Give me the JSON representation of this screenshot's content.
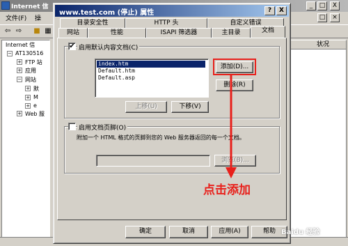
{
  "background_window": {
    "title": "Internet 信",
    "title_buttons": [
      "_",
      "□",
      "X"
    ],
    "menu": [
      "文件(F)",
      "操"
    ],
    "tree": [
      {
        "label": "Internet 信",
        "expander": ""
      },
      {
        "label": "AT130516",
        "expander": "−"
      },
      {
        "label": "FTP 站",
        "expander": "+"
      },
      {
        "label": "应用",
        "expander": "+"
      },
      {
        "label": "网站",
        "expander": "−"
      },
      {
        "label": "默",
        "expander": "+"
      },
      {
        "label": "M",
        "expander": "+"
      },
      {
        "label": "e",
        "expander": "+"
      },
      {
        "label": "Web 服",
        "expander": "+"
      }
    ],
    "list_header": "状况"
  },
  "dialog": {
    "title": "www.test.com (停止) 属性",
    "help_button": "?",
    "close_button": "X",
    "tabs_back": [
      "目录安全性",
      "HTTP 头",
      "自定义错误"
    ],
    "tabs_front": [
      "网站",
      "性能",
      "ISAPI 筛选器",
      "主目录",
      "文档"
    ],
    "active_tab": "文档",
    "default_doc": {
      "checkbox_label": "启用默认内容文档(C)",
      "checked": true,
      "documents": [
        "index.htm",
        "Default.htm",
        "Default.asp"
      ],
      "selected_index": 0,
      "add_button": "添加(D)...",
      "remove_button": "删除(R)",
      "move_up_button": "上移(U)",
      "move_down_button": "下移(V)"
    },
    "footer": {
      "checkbox_label": "启用文档页脚(O)",
      "checked": false,
      "description": "附加一个 HTML 格式的页脚到您的 Web 服务器返回的每一个文档。",
      "browse_button": "浏览(B)..."
    },
    "bottom_buttons": {
      "ok": "确定",
      "cancel": "取消",
      "apply": "应用(A)",
      "help": "帮助"
    }
  },
  "annotation": {
    "text": "点击添加",
    "color": "#e8201b"
  },
  "watermark": "Baidu 经验",
  "colors": {
    "dialog_title_start": "#0a246a",
    "dialog_title_end": "#a6caf0",
    "face": "#d4d0c8",
    "selection": "#0a246a"
  }
}
